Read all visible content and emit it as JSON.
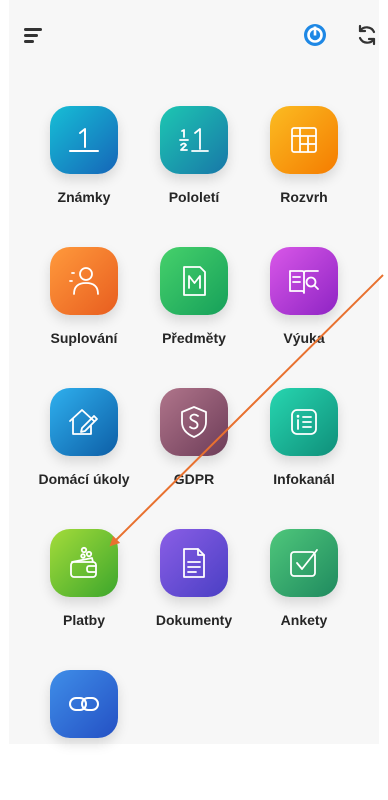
{
  "colors": {
    "accent": "#1e88e5",
    "arrow": "#e8712f",
    "background": "#f7f7f7"
  },
  "toolbar": {
    "menu_icon": "hamburger-menu-icon",
    "account_icon": "bakalari-logo-icon",
    "refresh_icon": "refresh-icon"
  },
  "tiles": [
    {
      "label": "Známky",
      "icon": "grade-one-icon",
      "gradient": [
        "#17bfd6",
        "#1565b8"
      ]
    },
    {
      "label": "Pololetí",
      "icon": "half-one-icon",
      "gradient": [
        "#1dc7b2",
        "#1877a8"
      ]
    },
    {
      "label": "Rozvrh",
      "icon": "timetable-grid-icon",
      "gradient": [
        "#fbbc22",
        "#f57c00"
      ]
    },
    {
      "label": "Suplování",
      "icon": "substitute-person-icon",
      "gradient": [
        "#ff9a3c",
        "#e85d1f"
      ]
    },
    {
      "label": "Předměty",
      "icon": "subjects-m-icon",
      "gradient": [
        "#46d16b",
        "#16a05a"
      ]
    },
    {
      "label": "Výuka",
      "icon": "lesson-book-icon",
      "gradient": [
        "#d957e8",
        "#8e24c4"
      ]
    },
    {
      "label": "Domácí úkoly",
      "icon": "homework-house-icon",
      "gradient": [
        "#2fb0ee",
        "#0d5ea6"
      ]
    },
    {
      "label": "GDPR",
      "icon": "gdpr-shield-icon",
      "gradient": [
        "#b0758b",
        "#6d3c58"
      ]
    },
    {
      "label": "Infokanál",
      "icon": "infochannel-list-icon",
      "gradient": [
        "#27d6b0",
        "#0f8f7a"
      ]
    },
    {
      "label": "Platby",
      "icon": "wallet-payments-icon",
      "gradient": [
        "#a4dc3a",
        "#3ca62c"
      ]
    },
    {
      "label": "Dokumenty",
      "icon": "document-icon",
      "gradient": [
        "#8a5ee6",
        "#4a3fc4"
      ]
    },
    {
      "label": "Ankety",
      "icon": "poll-checkbox-icon",
      "gradient": [
        "#4fc77b",
        "#1f8a5f"
      ]
    },
    {
      "label": "",
      "icon": "link-chain-icon",
      "gradient": [
        "#3f8ee8",
        "#2450c4"
      ]
    }
  ]
}
